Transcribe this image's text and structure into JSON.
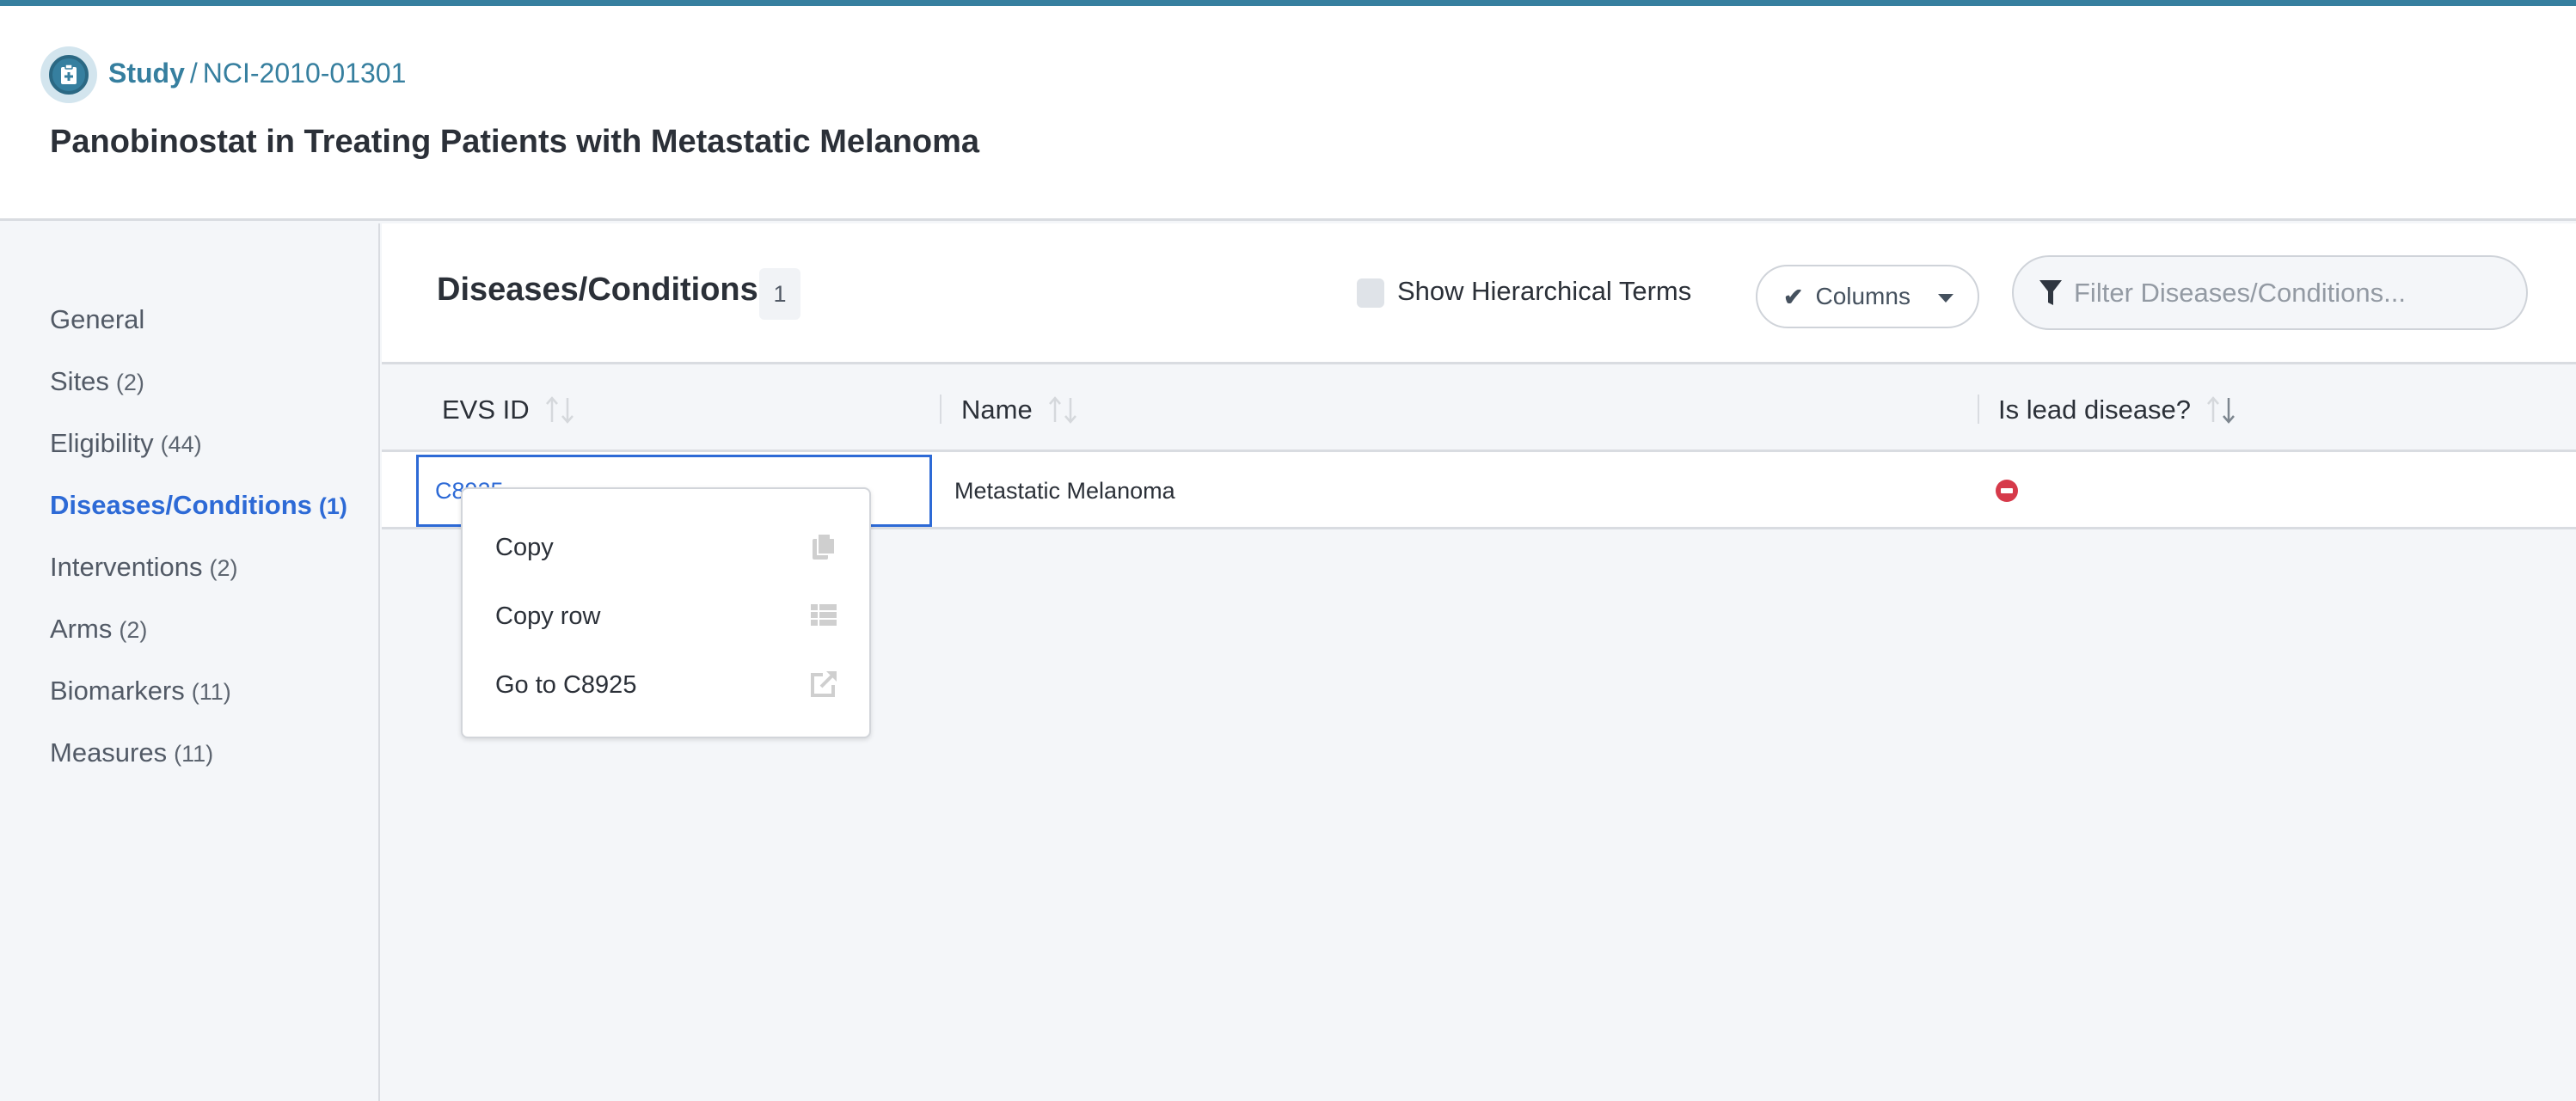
{
  "header": {
    "breadcrumb": {
      "icon": "clipboard-medical-icon",
      "root_label": "Study",
      "separator": "/",
      "current_label": "NCI-2010-01301"
    },
    "title": "Panobinostat in Treating Patients with Metastatic Melanoma"
  },
  "sidebar": {
    "items": [
      {
        "label": "General",
        "count": ""
      },
      {
        "label": "Sites",
        "count": "(2)"
      },
      {
        "label": "Eligibility",
        "count": "(44)"
      },
      {
        "label": "Diseases/Conditions",
        "count": "(1)",
        "active": true
      },
      {
        "label": "Interventions",
        "count": "(2)"
      },
      {
        "label": "Arms",
        "count": "(2)"
      },
      {
        "label": "Biomarkers",
        "count": "(11)"
      },
      {
        "label": "Measures",
        "count": "(11)"
      }
    ]
  },
  "section": {
    "title": "Diseases/Conditions",
    "count": "1",
    "show_hierarchical_label": "Show Hierarchical Terms",
    "show_hierarchical_checked": false,
    "columns_button_label": "Columns",
    "filter_placeholder": "Filter Diseases/Conditions...",
    "filter_value": ""
  },
  "table": {
    "columns": [
      {
        "label": "EVS ID",
        "sort": "none"
      },
      {
        "label": "Name",
        "sort": "none"
      },
      {
        "label": "Is lead disease?",
        "sort": "descending"
      }
    ],
    "rows": [
      {
        "evs_id": "C8925",
        "name": "Metastatic Melanoma",
        "is_lead": "no",
        "is_lead_icon": "minus-circle-icon"
      }
    ]
  },
  "context_menu": {
    "items": [
      {
        "label": "Copy",
        "icon": "copy-icon"
      },
      {
        "label": "Copy row",
        "icon": "table-rows-icon"
      },
      {
        "label": "Go to C8925",
        "icon": "external-link-icon"
      }
    ]
  },
  "colors": {
    "brand": "#367f9f",
    "accent": "#2d6ad6",
    "danger": "#d63a4a",
    "background": "#f4f6f9"
  }
}
